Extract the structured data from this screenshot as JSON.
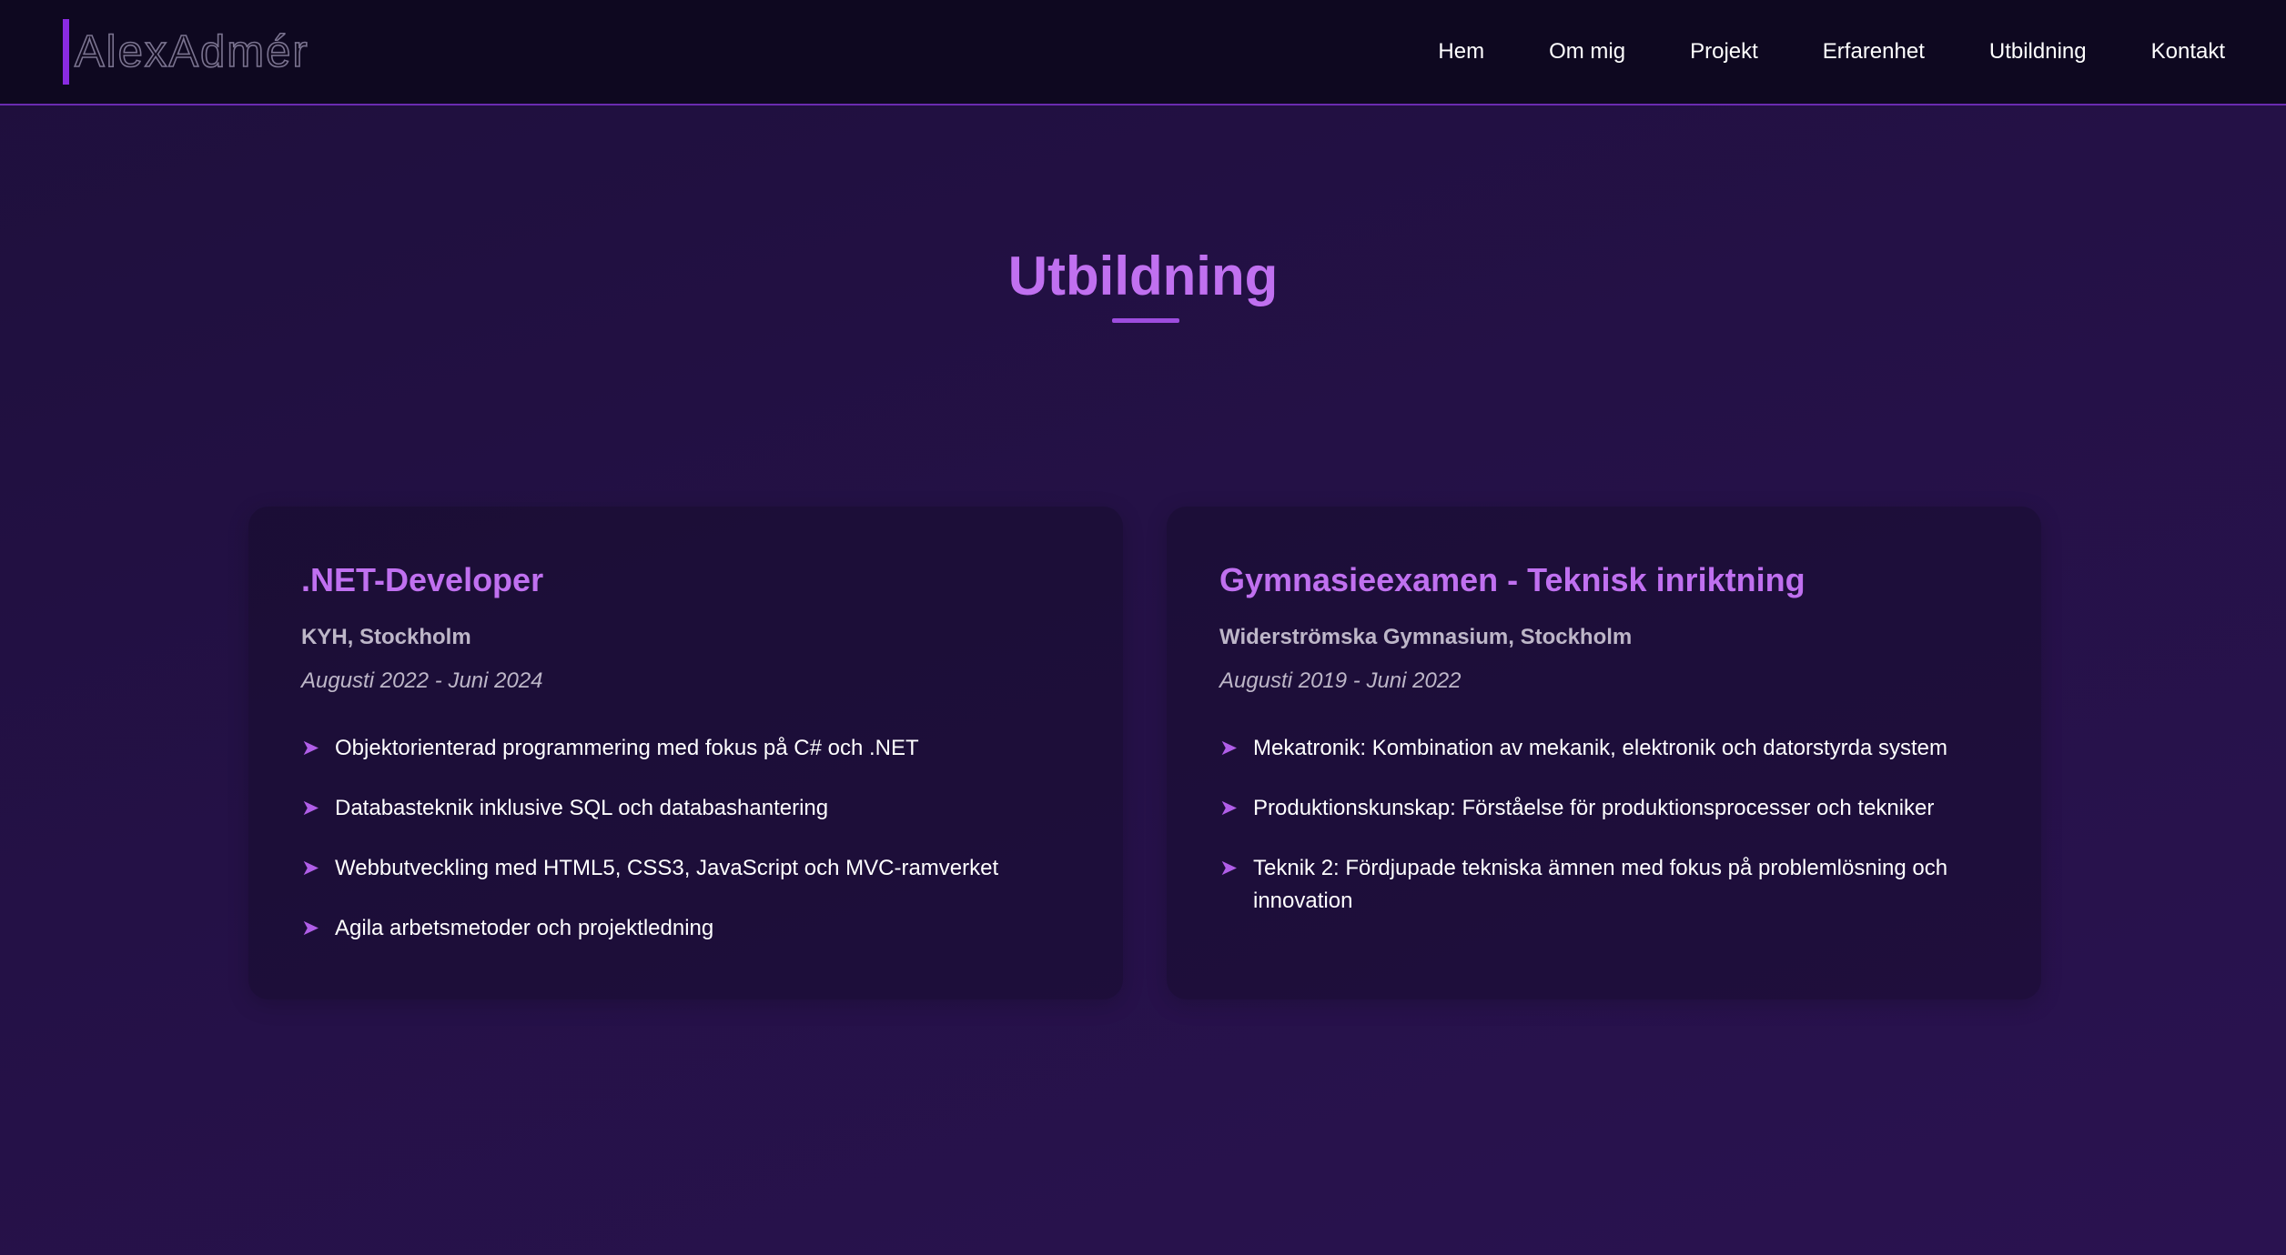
{
  "header": {
    "logo": "AlexAdmér",
    "nav": [
      "Hem",
      "Om mig",
      "Projekt",
      "Erfarenhet",
      "Utbildning",
      "Kontakt"
    ]
  },
  "section": {
    "title": "Utbildning"
  },
  "education": [
    {
      "title": ".NET-Developer",
      "school": "KYH, Stockholm",
      "dates": "Augusti 2022 - Juni 2024",
      "items": [
        "Objektorienterad programmering med fokus på C# och .NET",
        "Databasteknik inklusive SQL och databashantering",
        "Webbutveckling med HTML5, CSS3, JavaScript och MVC-ramverket",
        "Agila arbetsmetoder och projektledning"
      ]
    },
    {
      "title": "Gymnasieexamen - Teknisk inriktning",
      "school": "Widerströmska Gymnasium, Stockholm",
      "dates": "Augusti 2019 - Juni 2022",
      "items": [
        "Mekatronik: Kombination av mekanik, elektronik och datorstyrda system",
        "Produktionskunskap: Förståelse för produktionsprocesser och tekniker",
        "Teknik 2: Fördjupade tekniska ämnen med fokus på problemlösning och innovation"
      ]
    }
  ],
  "icons": {
    "bullet": "arrow-right-icon"
  },
  "colors": {
    "accent": "#c070f0",
    "brand_bar": "#8a2be2",
    "header_bg": "#0e0820",
    "page_bg": "#241146"
  }
}
